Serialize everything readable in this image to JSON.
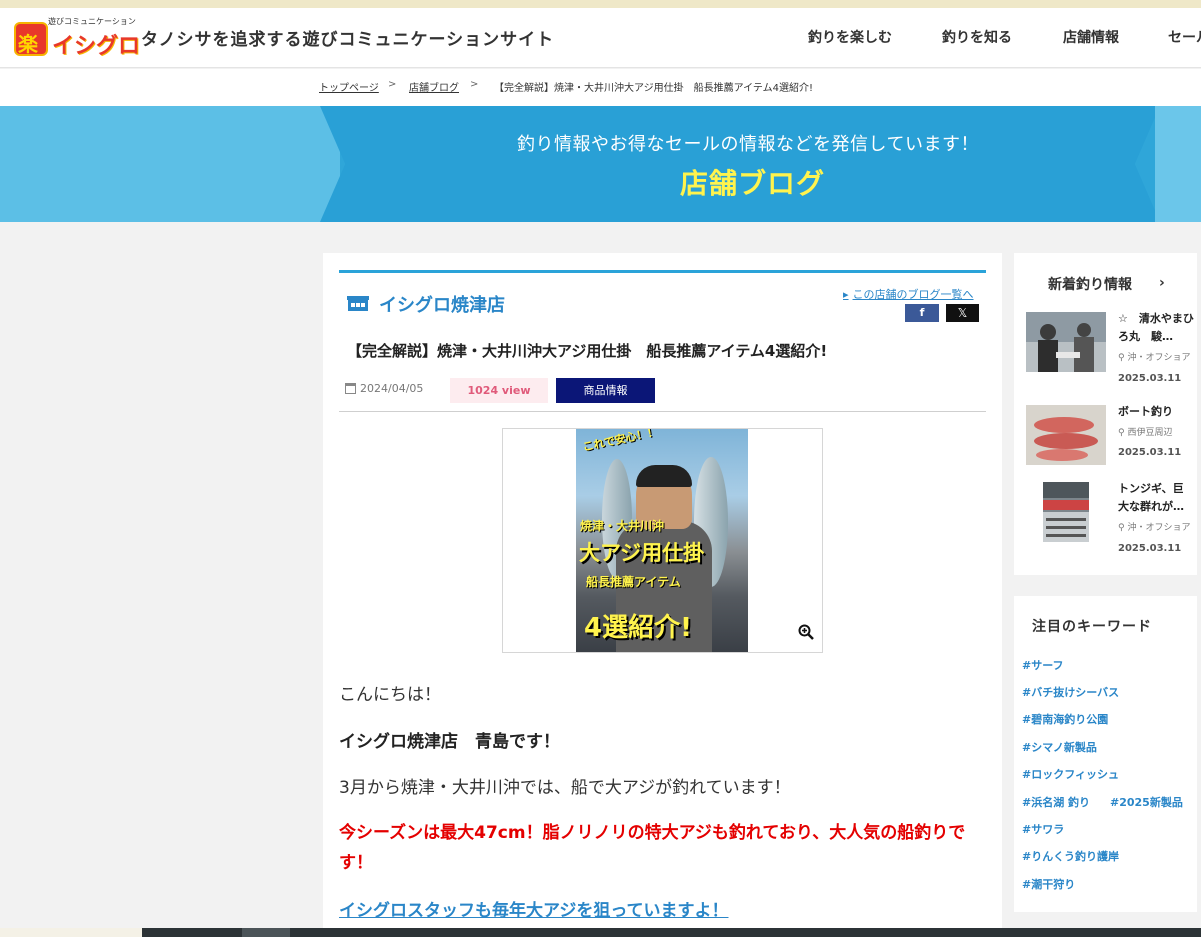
{
  "header": {
    "logo_small": "遊びコミュニケーション",
    "logo_mark": "楽",
    "logo_word": "イシグロ",
    "tagline": "タノシサを追求する遊びコミュニケーションサイト",
    "nav": [
      "釣りを楽しむ",
      "釣りを知る",
      "店舗情報",
      "セール"
    ]
  },
  "breadcrumb": {
    "home": "トップページ",
    "sep": ">",
    "blog": "店舗ブログ",
    "current": "【完全解説】焼津・大井川沖大アジ用仕掛　船長推薦アイテム4選紹介!"
  },
  "banner": {
    "subtitle": "釣り情報やお得なセールの情報などを発信しています！",
    "title": "店舗ブログ"
  },
  "article": {
    "store_name": "イシグロ焼津店",
    "bloglist_caret": "▸",
    "bloglist_link": "この店舗のブログ一覧へ",
    "share_facebook": "f",
    "share_x": "𝕏",
    "title": "【完全解説】焼津・大井川沖大アジ用仕掛　船長推薦アイテム4選紹介!",
    "date": "2024/04/05",
    "views": "1024 view",
    "category": "商品情報",
    "image_text": {
      "line1": "これで安心！！",
      "line2": "焼津・大井川沖",
      "line3": "大アジ用仕掛",
      "line4": "船長推薦アイテム",
      "line5": "4選紹介!"
    },
    "greeting": "こんにちは！",
    "staff": "イシグロ焼津店　青島です！",
    "intro": "3月から焼津・大井川沖では、船で大アジが釣れています！",
    "highlight": "今シーズンは最大47cm！脂ノリノリの特大アジも釣れており、大人気の船釣りです！",
    "staff_link": "イシグロスタッフも毎年大アジを狙っていますよ！"
  },
  "sidebar": {
    "news_title": "新着釣り情報",
    "news_chevron": "›",
    "news": [
      {
        "headline": "☆　清水やまひろ丸　駿…",
        "loc": "沖・オフショア",
        "date": "2025.03.11"
      },
      {
        "headline": "ボート釣り",
        "loc": "西伊豆周辺",
        "date": "2025.03.11"
      },
      {
        "headline": "トンジギ、巨大な群れが…",
        "loc": "沖・オフショア",
        "date": "2025.03.11"
      }
    ],
    "keywords_title": "注目のキーワード",
    "keywords": [
      "#サーフ",
      "#バチ抜けシーバス",
      "#碧南海釣り公園",
      "#シマノ新製品",
      "#ロックフィッシュ",
      "#浜名湖 釣り",
      "#2025新製品",
      "#サワラ",
      "#りんくう釣り護岸",
      "#潮干狩り"
    ]
  },
  "colors": {
    "accent_blue": "#2aa3d9",
    "banner_title": "#fff34d",
    "highlight_red": "#e40000",
    "category_navy": "#0b1677",
    "logo_red": "#e8382a"
  }
}
